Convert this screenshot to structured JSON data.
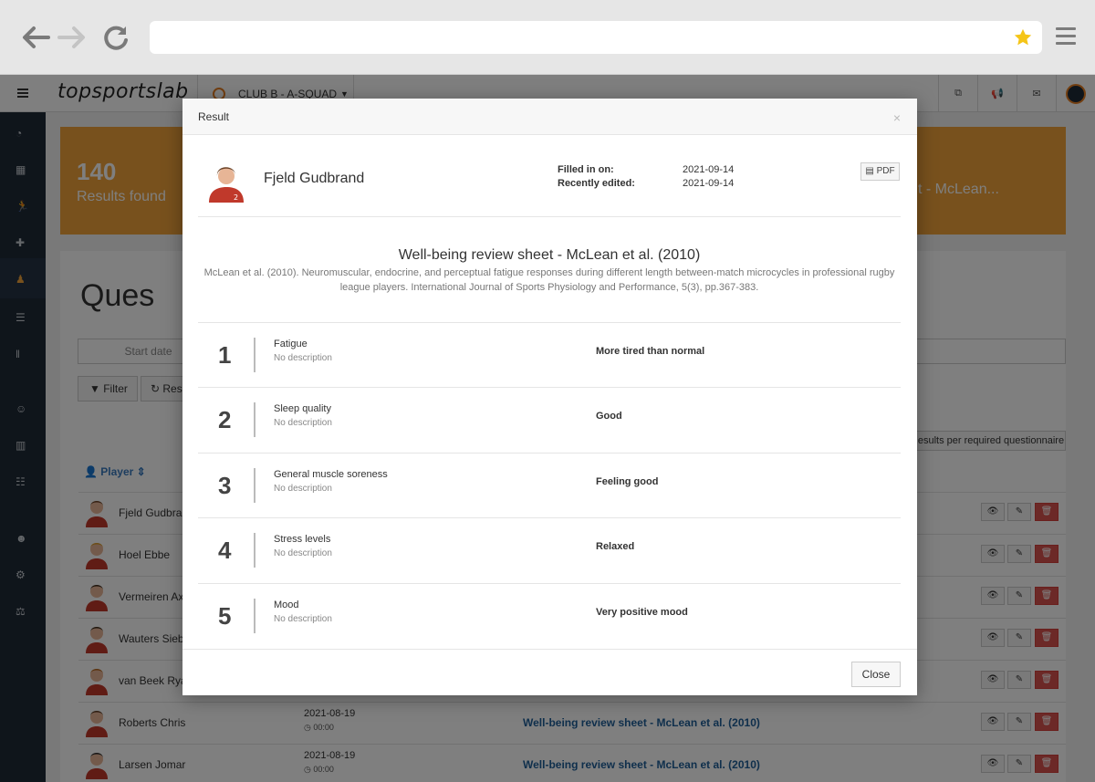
{
  "browser": {
    "url": ""
  },
  "app": {
    "logo": "topsportslab",
    "club": "CLUB B - A-SQUAD"
  },
  "stats": {
    "count": "140",
    "label": "Results found",
    "right_text": "t - McLean..."
  },
  "panel": {
    "title": "Ques",
    "start_date_placeholder": "Start date",
    "filter_label": "Filter",
    "reset_label": "Res",
    "required_label": "Results per required questionnaire",
    "player_column": "Player"
  },
  "rows": [
    {
      "name": "Fjeld Gudbran",
      "date": "",
      "time": "",
      "questionnaire": ""
    },
    {
      "name": "Hoel Ebbe",
      "date": "",
      "time": "",
      "questionnaire": ""
    },
    {
      "name": "Vermeiren Ax",
      "date": "",
      "time": "",
      "questionnaire": ""
    },
    {
      "name": "Wauters Siebe",
      "date": "",
      "time": "",
      "questionnaire": ""
    },
    {
      "name": "van Beek Ryan",
      "date": "",
      "time": "",
      "questionnaire": ""
    },
    {
      "name": "Roberts Chris",
      "date": "2021-08-19",
      "time": "00:00",
      "questionnaire": "Well-being review sheet - McLean et al. (2010)"
    },
    {
      "name": "Larsen Jomar",
      "date": "2021-08-19",
      "time": "00:00",
      "questionnaire": "Well-being review sheet - McLean et al. (2010)"
    }
  ],
  "modal": {
    "title": "Result",
    "player_name": "Fjeld Gudbrand",
    "filled_in_label": "Filled in on:",
    "filled_in_value": "2021-09-14",
    "edited_label": "Recently edited:",
    "edited_value": "2021-09-14",
    "pdf_label": "PDF",
    "questionnaire_title": "Well-being review sheet - McLean et al. (2010)",
    "reference": "McLean et al. (2010). Neuromuscular, endocrine, and perceptual fatigue responses during different length between-match microcycles in professional rugby league players. International Journal of Sports Physiology and Performance, 5(3), pp.367-383.",
    "questions": [
      {
        "num": "1",
        "name": "Fatigue",
        "desc": "No description",
        "answer": "More tired than normal"
      },
      {
        "num": "2",
        "name": "Sleep quality",
        "desc": "No description",
        "answer": "Good"
      },
      {
        "num": "3",
        "name": "General muscle soreness",
        "desc": "No description",
        "answer": "Feeling good"
      },
      {
        "num": "4",
        "name": "Stress levels",
        "desc": "No description",
        "answer": "Relaxed"
      },
      {
        "num": "5",
        "name": "Mood",
        "desc": "No description",
        "answer": "Very positive mood"
      }
    ],
    "close_label": "Close"
  },
  "colors": {
    "accent": "#f0a33a",
    "link": "#1f5f99",
    "danger": "#d9534f",
    "sidebar": "#1f2a37"
  }
}
